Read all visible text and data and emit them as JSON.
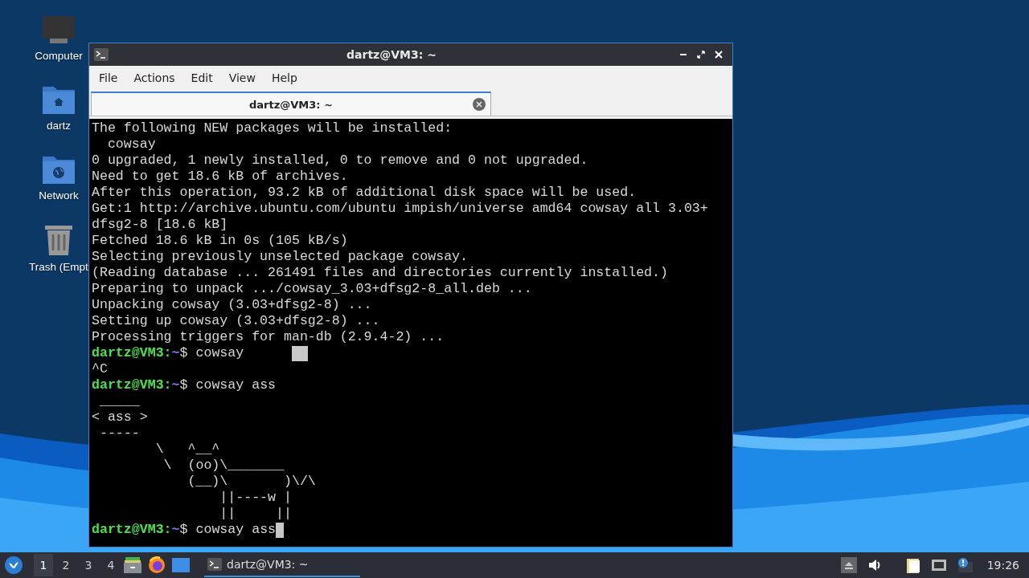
{
  "desktop_icons": [
    {
      "kind": "computer",
      "label": "Computer"
    },
    {
      "kind": "home",
      "label": "dartz"
    },
    {
      "kind": "network",
      "label": "Network"
    },
    {
      "kind": "trash",
      "label": "Trash (Empt"
    }
  ],
  "window": {
    "title": "dartz@VM3: ~",
    "menu": [
      "File",
      "Actions",
      "Edit",
      "View",
      "Help"
    ],
    "tabs": [
      {
        "label": "dartz@VM3: ~",
        "selected": true
      }
    ],
    "terminal": [
      {
        "kind": "output",
        "text": "The following NEW packages will be installed:"
      },
      {
        "kind": "output",
        "text": "  cowsay"
      },
      {
        "kind": "output",
        "text": "0 upgraded, 1 newly installed, 0 to remove and 0 not upgraded."
      },
      {
        "kind": "output",
        "text": "Need to get 18.6 kB of archives."
      },
      {
        "kind": "output",
        "text": "After this operation, 93.2 kB of additional disk space will be used."
      },
      {
        "kind": "output",
        "text": "Get:1 http://archive.ubuntu.com/ubuntu impish/universe amd64 cowsay all 3.03+"
      },
      {
        "kind": "output",
        "text": "dfsg2-8 [18.6 kB]"
      },
      {
        "kind": "output",
        "text": "Fetched 18.6 kB in 0s (105 kB/s)"
      },
      {
        "kind": "output",
        "text": "Selecting previously unselected package cowsay."
      },
      {
        "kind": "output",
        "text": "(Reading database ... 261491 files and directories currently installed.)"
      },
      {
        "kind": "output",
        "text": "Preparing to unpack .../cowsay_3.03+dfsg2-8_all.deb ..."
      },
      {
        "kind": "output",
        "text": "Unpacking cowsay (3.03+dfsg2-8) ..."
      },
      {
        "kind": "output",
        "text": "Setting up cowsay (3.03+dfsg2-8) ..."
      },
      {
        "kind": "output",
        "text": "Processing triggers for man-db (2.9.4-2) ..."
      },
      {
        "kind": "prompt",
        "host": "dartz@VM3:",
        "path": "~",
        "command": "$ cowsay",
        "cursor": true,
        "cursor_detached": true
      },
      {
        "kind": "output",
        "text": "^C"
      },
      {
        "kind": "prompt",
        "host": "dartz@VM3:",
        "path": "~",
        "command": "$ cowsay ass",
        "cursor": false
      },
      {
        "kind": "output",
        "text": " _____"
      },
      {
        "kind": "output",
        "text": "< ass >"
      },
      {
        "kind": "output",
        "text": " -----"
      },
      {
        "kind": "output",
        "text": "        \\   ^__^"
      },
      {
        "kind": "output",
        "text": "         \\  (oo)\\_______"
      },
      {
        "kind": "output",
        "text": "            (__)\\       )\\/\\"
      },
      {
        "kind": "output",
        "text": "                ||----w |"
      },
      {
        "kind": "output",
        "text": "                ||     ||"
      },
      {
        "kind": "prompt",
        "host": "dartz@VM3:",
        "path": "~",
        "command": "$ cowsay ass",
        "cursor": true,
        "cursor_detached": false
      }
    ]
  },
  "taskbar": {
    "workspaces": [
      {
        "label": "1",
        "selected": true
      },
      {
        "label": "2",
        "selected": false
      },
      {
        "label": "3",
        "selected": false
      },
      {
        "label": "4",
        "selected": false
      }
    ],
    "tasks": [
      {
        "label": "dartz@VM3: ~",
        "selected": true
      }
    ],
    "clock": "19:26"
  }
}
